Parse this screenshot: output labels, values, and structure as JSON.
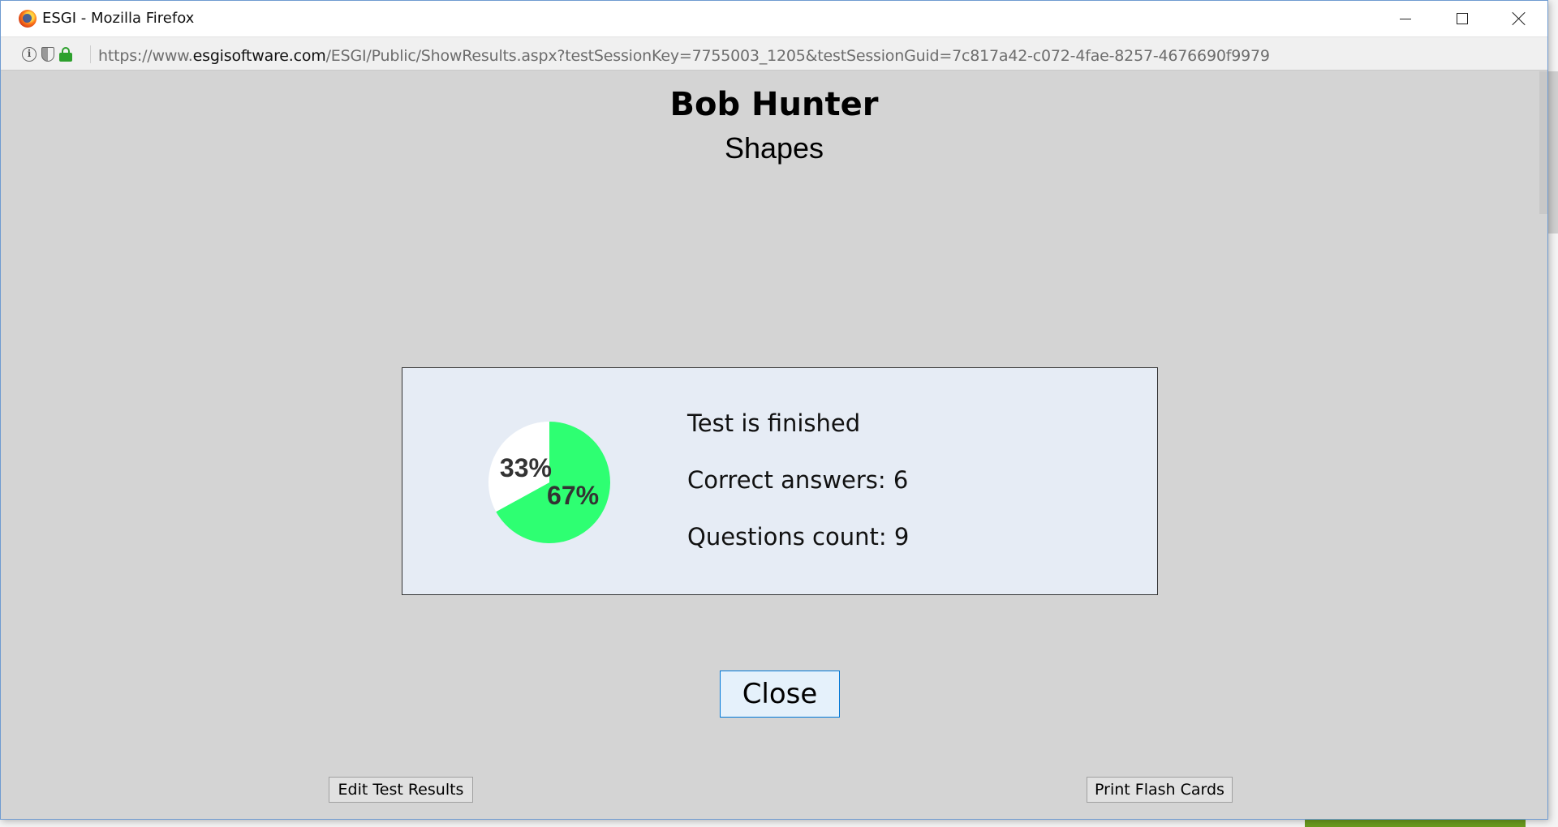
{
  "window": {
    "title": "ESGI - Mozilla Firefox",
    "url_prefix": "https://www.",
    "url_domain": "esgisoftware.com",
    "url_path": "/ESGI/Public/ShowResults.aspx?testSessionKey=7755003_1205&testSessionGuid=7c817a42-c072-4fae-8257-4676690f9979"
  },
  "header": {
    "student_name": "Bob Hunter",
    "test_name": "Shapes"
  },
  "results": {
    "status": "Test is finished",
    "correct_answers": "Correct answers: 6",
    "questions_count": "Questions count: 9"
  },
  "chart_data": {
    "type": "pie",
    "slices": [
      {
        "label": "33%",
        "value": 33,
        "color": "#ffffff"
      },
      {
        "label": "67%",
        "value": 67,
        "color": "#2eff72"
      }
    ]
  },
  "buttons": {
    "close": "Close",
    "edit_results": "Edit Test Results",
    "print_flash_cards": "Print Flash Cards"
  },
  "colors": {
    "popup_bg": "#d4d4d4",
    "result_box_bg": "#e6ecf5",
    "correct": "#2eff72",
    "incorrect": "#ffffff"
  }
}
